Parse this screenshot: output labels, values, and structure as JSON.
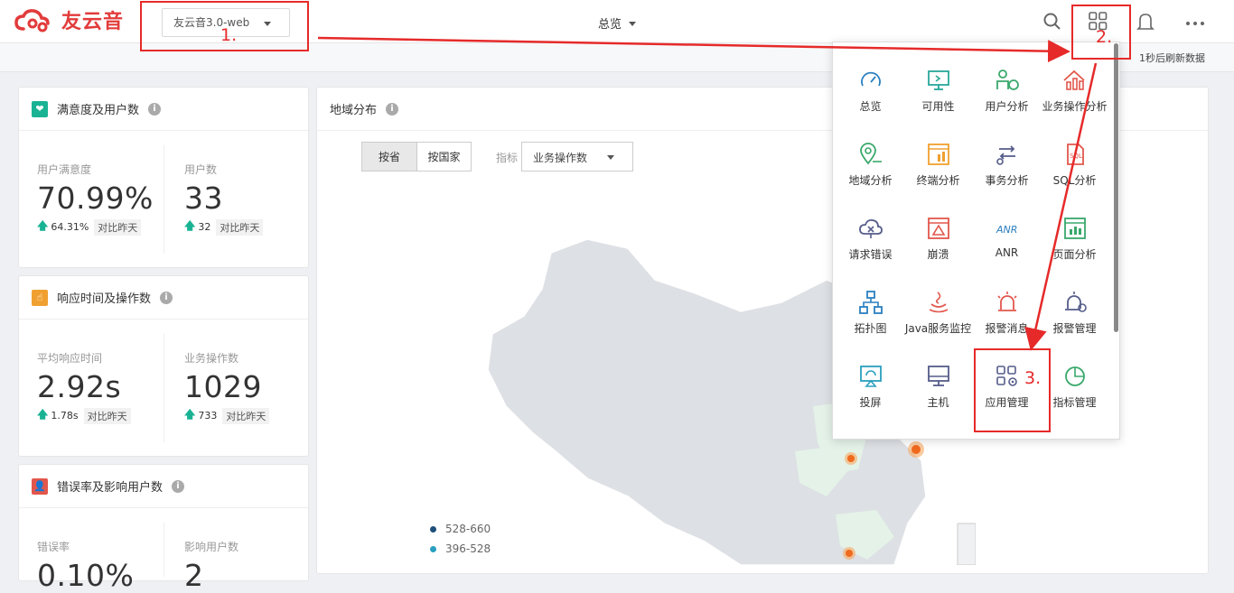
{
  "header": {
    "brand": "友云音",
    "app_selector": "友云音3.0-web",
    "nav_title": "总览",
    "refresh_text": "1秒后刷新数据"
  },
  "cards": {
    "satisfaction": {
      "title": "满意度及用户数",
      "metrics": [
        {
          "label": "用户满意度",
          "value": "70.99%",
          "delta": "64.31%",
          "compare": "对比昨天"
        },
        {
          "label": "用户数",
          "value": "33",
          "delta": "32",
          "compare": "对比昨天"
        }
      ]
    },
    "response": {
      "title": "响应时间及操作数",
      "metrics": [
        {
          "label": "平均响应时间",
          "value": "2.92s",
          "delta": "1.78s",
          "compare": "对比昨天"
        },
        {
          "label": "业务操作数",
          "value": "1029",
          "delta": "733",
          "compare": "对比昨天"
        }
      ]
    },
    "errors": {
      "title": "错误率及影响用户数",
      "metrics": [
        {
          "label": "错误率",
          "value": "0.10%"
        },
        {
          "label": "影响用户数",
          "value": "2"
        }
      ]
    },
    "map": {
      "title": "地域分布",
      "tabs": [
        "按省",
        "按国家"
      ],
      "metric_label": "指标",
      "metric_value": "业务操作数",
      "legend": [
        {
          "range": "528-660",
          "color": "#1f4e79"
        },
        {
          "range": "396-528",
          "color": "#2a9fbf"
        }
      ]
    }
  },
  "menu": {
    "items": [
      {
        "label": "总览",
        "icon": "gauge-icon",
        "color": "#2a7fc0"
      },
      {
        "label": "可用性",
        "icon": "monitor-icon",
        "color": "#29a89a"
      },
      {
        "label": "用户分析",
        "icon": "user-chart-icon",
        "color": "#39a86b"
      },
      {
        "label": "业务操作分析",
        "icon": "house-chart-icon",
        "color": "#e2574c"
      },
      {
        "label": "地域分析",
        "icon": "location-icon",
        "color": "#39a86b"
      },
      {
        "label": "终端分析",
        "icon": "terminal-chart-icon",
        "color": "#f0a030"
      },
      {
        "label": "事务分析",
        "icon": "transaction-icon",
        "color": "#555c8a"
      },
      {
        "label": "SQL分析",
        "icon": "sql-icon",
        "color": "#e2574c"
      },
      {
        "label": "请求错误",
        "icon": "cloud-error-icon",
        "color": "#555c8a"
      },
      {
        "label": "崩溃",
        "icon": "crash-icon",
        "color": "#e2574c"
      },
      {
        "label": "ANR",
        "icon": "anr-icon",
        "color": "#2a7fc0"
      },
      {
        "label": "页面分析",
        "icon": "page-chart-icon",
        "color": "#39a86b"
      },
      {
        "label": "拓扑图",
        "icon": "topology-icon",
        "color": "#2a7fc0"
      },
      {
        "label": "Java服务监控",
        "icon": "java-icon",
        "color": "#e2574c"
      },
      {
        "label": "报警消息",
        "icon": "alarm-icon",
        "color": "#e2574c"
      },
      {
        "label": "报警管理",
        "icon": "alarm-manage-icon",
        "color": "#555c8a"
      },
      {
        "label": "投屏",
        "icon": "cast-icon",
        "color": "#2a9fbf"
      },
      {
        "label": "主机",
        "icon": "host-icon",
        "color": "#555c8a"
      },
      {
        "label": "应用管理",
        "icon": "app-manage-icon",
        "color": "#555c8a"
      },
      {
        "label": "指标管理",
        "icon": "indicator-icon",
        "color": "#39a86b"
      }
    ]
  },
  "annotations": [
    "1.",
    "2.",
    "3."
  ]
}
